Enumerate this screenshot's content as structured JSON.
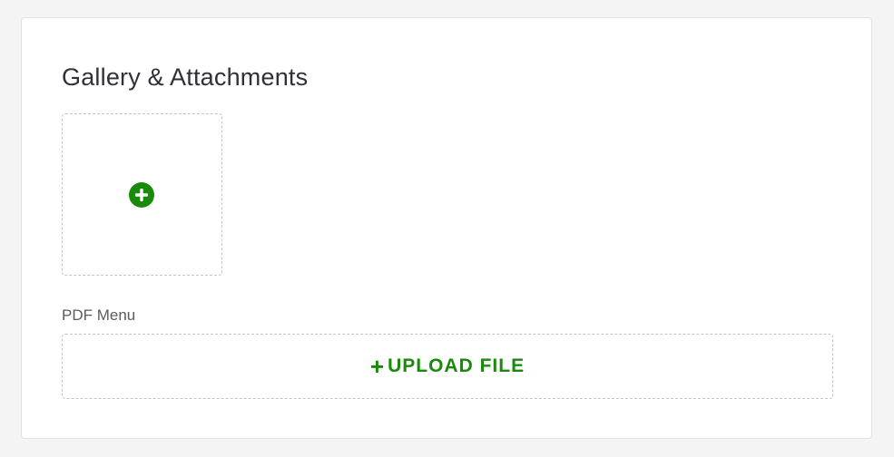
{
  "section": {
    "title": "Gallery & Attachments"
  },
  "gallery": {
    "add_icon": "plus-circle-icon",
    "accent_color": "#1a8a0a"
  },
  "pdf": {
    "label": "PDF Menu",
    "upload_plus": "+",
    "upload_label": "UPLOAD FILE"
  },
  "colors": {
    "background": "#f4f4f4",
    "card": "#ffffff",
    "accent": "#1a8a0a",
    "dashed_border": "#c4c4c4",
    "title_text": "#2f3038"
  }
}
